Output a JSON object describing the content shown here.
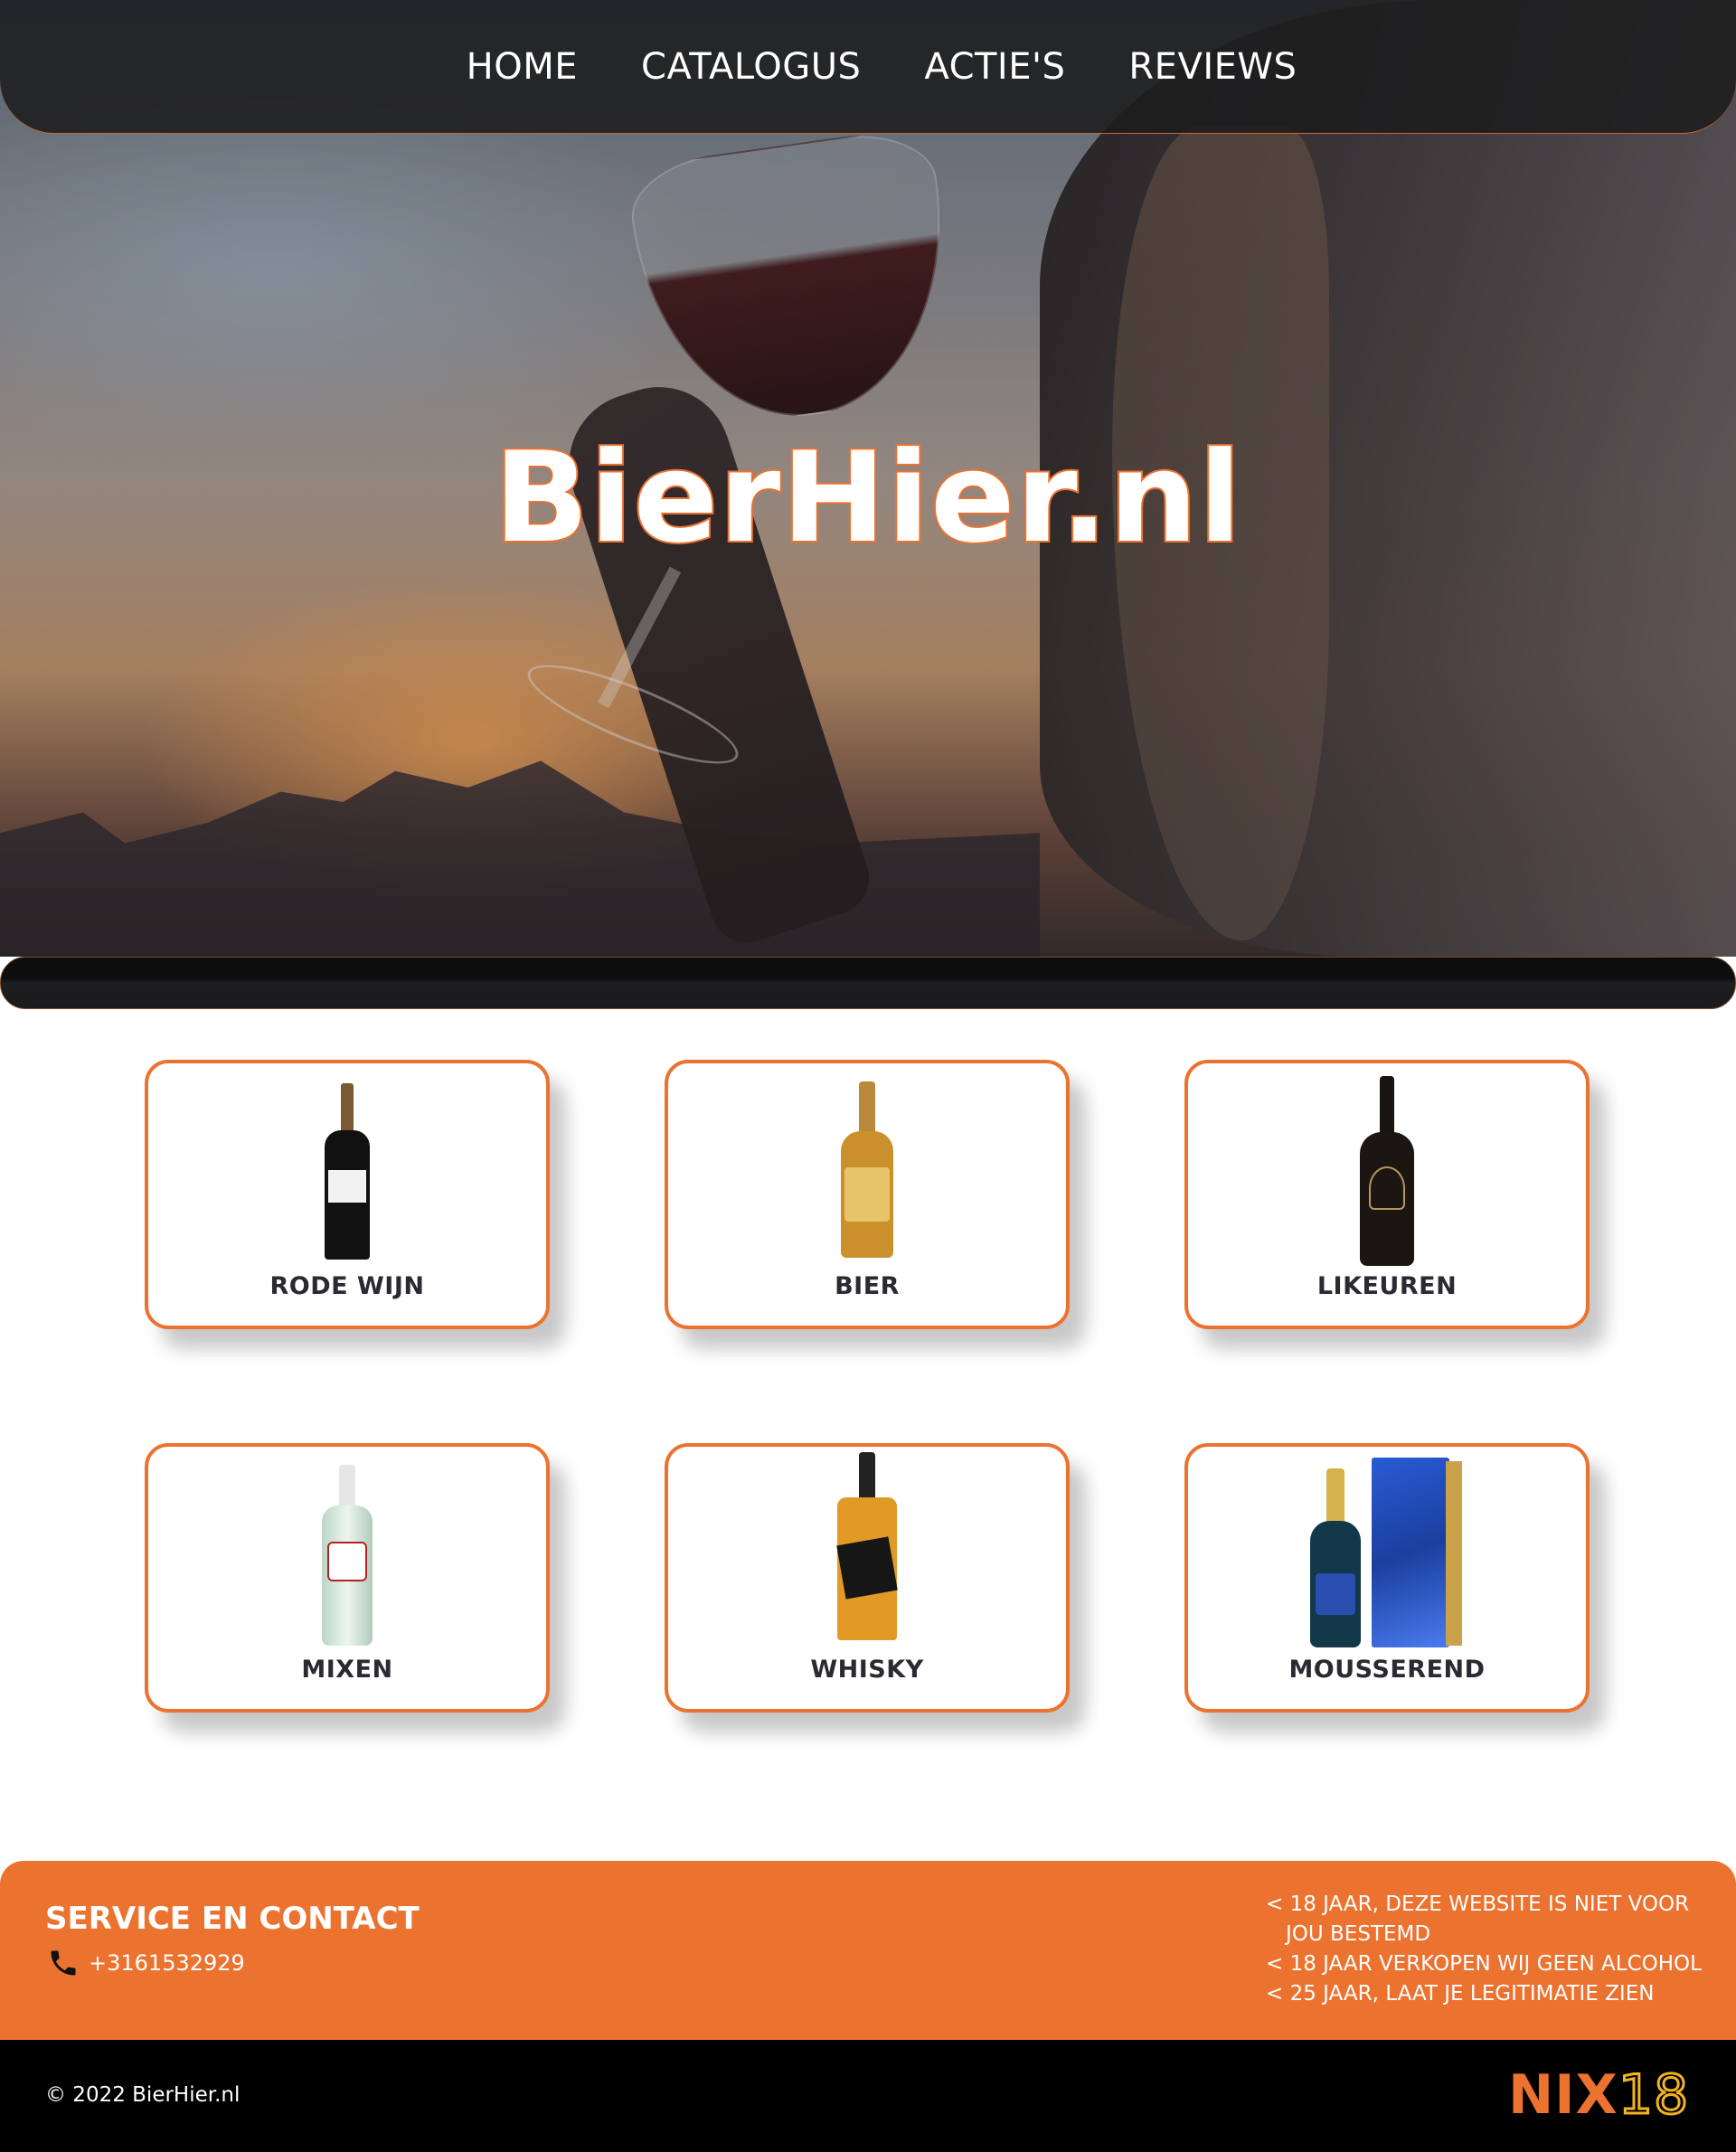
{
  "nav": {
    "items": [
      {
        "label": "HOME"
      },
      {
        "label": "CATALOGUS"
      },
      {
        "label": "ACTIE'S"
      },
      {
        "label": "REVIEWS"
      }
    ]
  },
  "hero": {
    "title": "BierHier.nl"
  },
  "categories": [
    {
      "label": "RODE WIJN",
      "icon": "red-wine-bottle"
    },
    {
      "label": "BIER",
      "icon": "beer-bottle"
    },
    {
      "label": "LIKEUREN",
      "icon": "liqueur-bottle"
    },
    {
      "label": "MIXEN",
      "icon": "rum-bottle"
    },
    {
      "label": "WHISKY",
      "icon": "whisky-bottle"
    },
    {
      "label": "MOUSSEREND",
      "icon": "champagne-bottle"
    }
  ],
  "footer": {
    "service_title": "SERVICE EN CONTACT",
    "phone": "+3161532929",
    "age_notices": [
      "< 18 JAAR, DEZE WEBSITE IS NIET VOOR JOU BESTEMD",
      "< 18 JAAR VERKOPEN WIJ GEEN ALCOHOL",
      "< 25 JAAR, LAAT JE LEGITIMATIE ZIEN"
    ],
    "copyright": "© 2022 BierHier.nl",
    "nix_logo": "NIX18"
  },
  "colors": {
    "accent": "#ec7230",
    "nav_bg": "#1c1c1e",
    "footer_bg": "#000000",
    "nix_yellow": "#f2b420"
  }
}
